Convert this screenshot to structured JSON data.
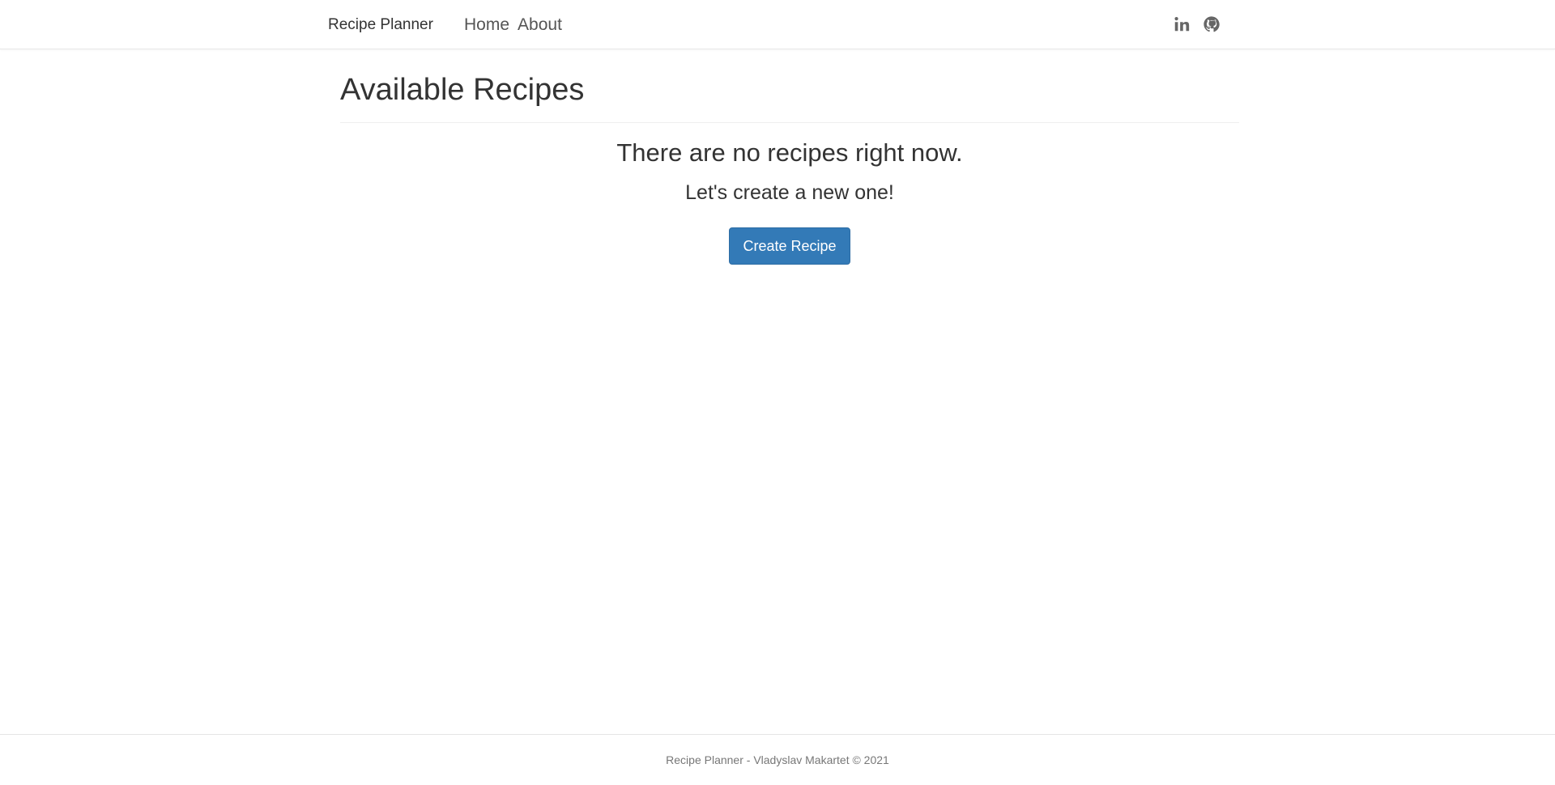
{
  "navbar": {
    "brand": "Recipe Planner",
    "links": [
      {
        "label": "Home"
      },
      {
        "label": "About"
      }
    ],
    "icons": [
      {
        "name": "linkedin-icon"
      },
      {
        "name": "github-icon"
      }
    ]
  },
  "main": {
    "title": "Available Recipes",
    "empty_heading": "There are no recipes right now.",
    "empty_subheading": "Let's create a new one!",
    "create_button_label": "Create Recipe"
  },
  "footer": {
    "text": "Recipe Planner - Vladyslav Makartet © 2021"
  },
  "colors": {
    "primary_button": "#337ab7",
    "text": "#333333",
    "muted_text": "#777777"
  }
}
